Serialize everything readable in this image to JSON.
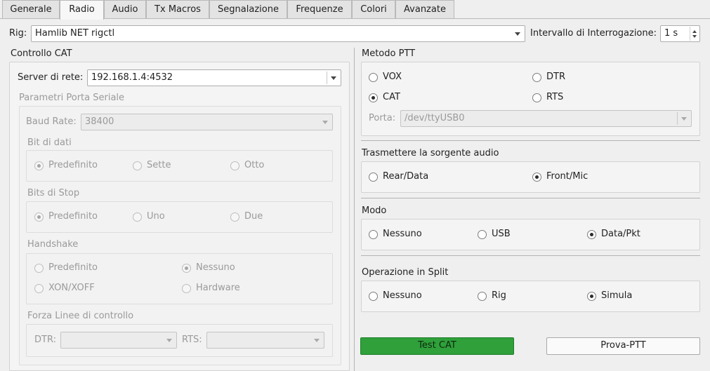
{
  "tabs": [
    "Generale",
    "Radio",
    "Audio",
    "Tx Macros",
    "Segnalazione",
    "Frequenze",
    "Colori",
    "Avanzate"
  ],
  "rig": {
    "label": "Rig:",
    "value": "Hamlib NET rigctl"
  },
  "poll": {
    "label": "Intervallo di Interrogazione:",
    "value": "1 s"
  },
  "cat": {
    "title": "Controllo CAT",
    "server_label": "Server di rete:",
    "server_value": "192.168.1.4:4532",
    "serial": {
      "title": "Parametri Porta Seriale",
      "baud_label": "Baud Rate:",
      "baud_value": "38400",
      "data_bits": {
        "title": "Bit di dati",
        "options": [
          "Predefinito",
          "Sette",
          "Otto"
        ]
      },
      "stop_bits": {
        "title": "Bits di Stop",
        "options": [
          "Predefinito",
          "Uno",
          "Due"
        ]
      },
      "handshake": {
        "title": "Handshake",
        "options": [
          "Predefinito",
          "Nessuno",
          "XON/XOFF",
          "Hardware"
        ]
      },
      "control": {
        "title": "Forza Linee di controllo",
        "dtr_label": "DTR:",
        "rts_label": "RTS:"
      }
    }
  },
  "ptt": {
    "title": "Metodo PTT",
    "options": [
      "VOX",
      "DTR",
      "CAT",
      "RTS"
    ],
    "port_label": "Porta:",
    "port_value": "/dev/ttyUSB0"
  },
  "audio_source": {
    "title": "Trasmettere la sorgente audio",
    "options": [
      "Rear/Data",
      "Front/Mic"
    ]
  },
  "mode": {
    "title": "Modo",
    "options": [
      "Nessuno",
      "USB",
      "Data/Pkt"
    ]
  },
  "split": {
    "title": "Operazione in Split",
    "options": [
      "Nessuno",
      "Rig",
      "Simula"
    ]
  },
  "buttons": {
    "test_cat": "Test CAT",
    "test_ptt": "Prova-PTT"
  },
  "colors": {
    "accent_green": "#2fa03a",
    "window_bg": "#efefef"
  }
}
